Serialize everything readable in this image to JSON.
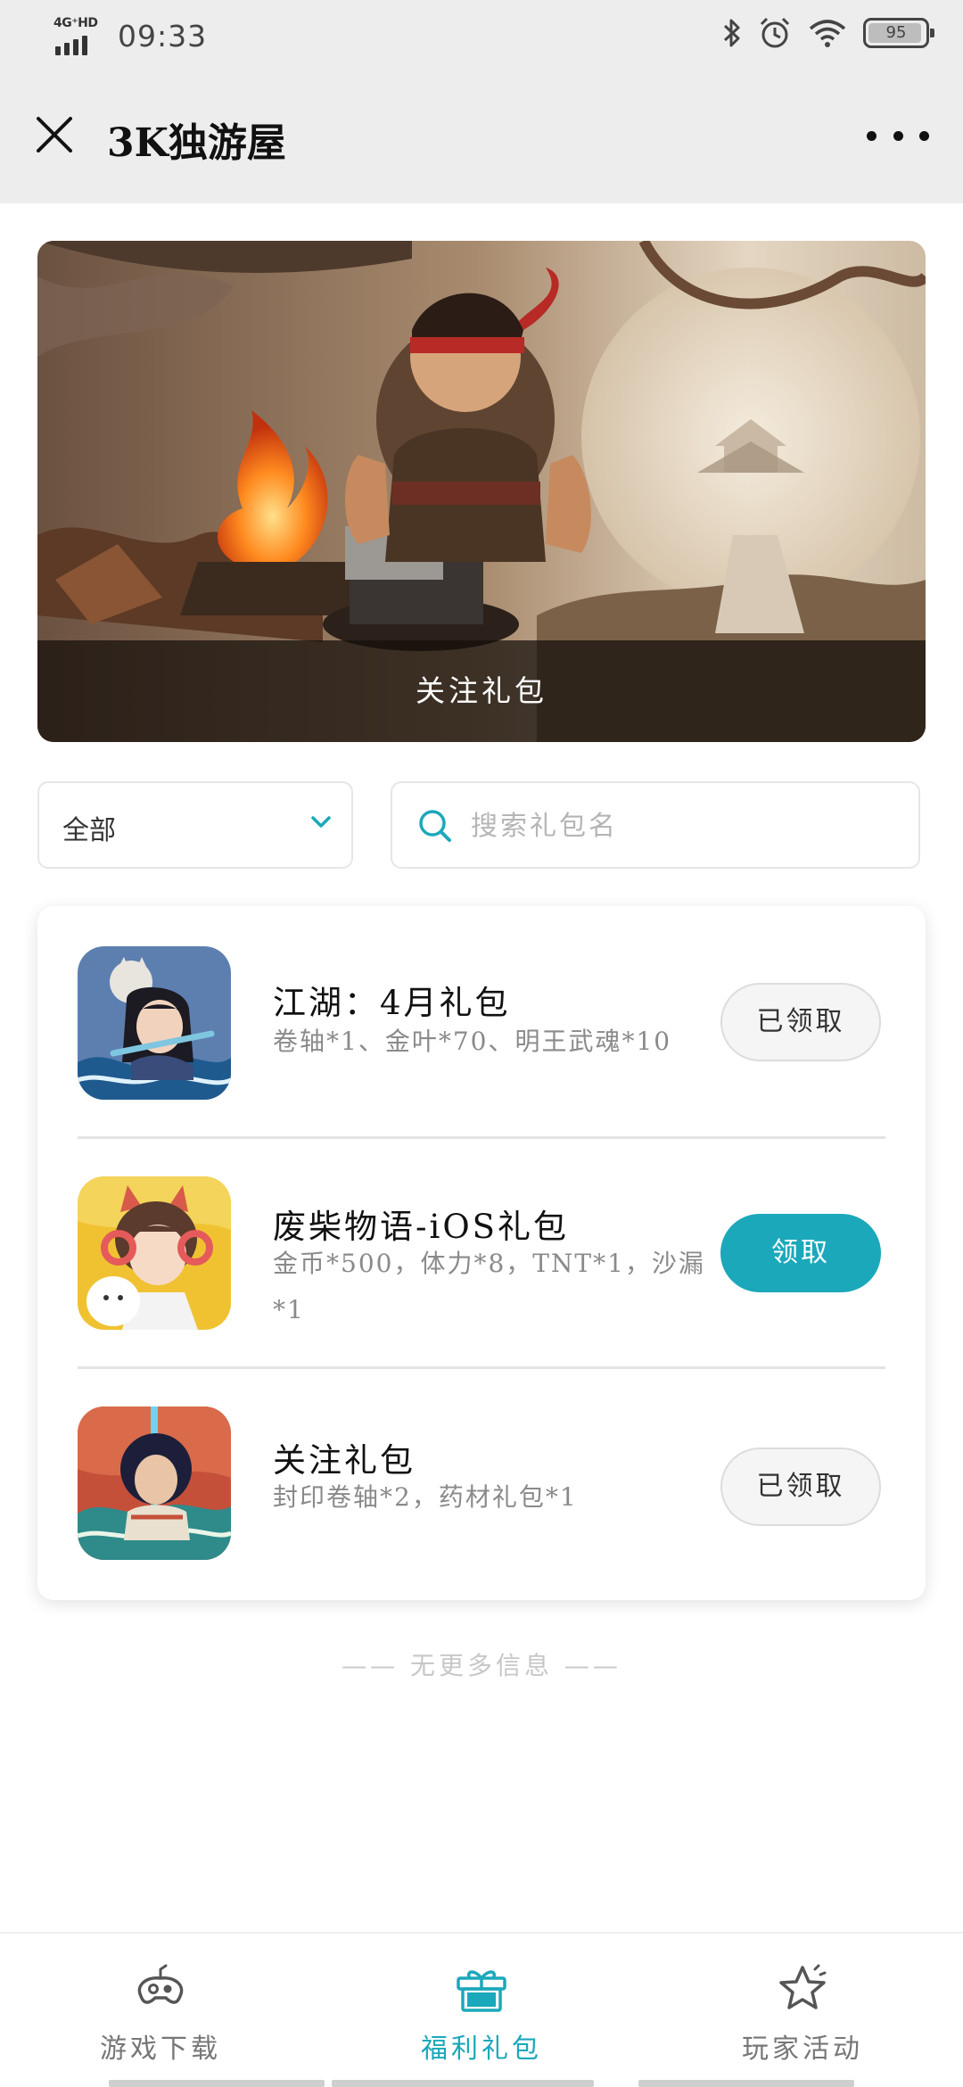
{
  "status_bar": {
    "network": "4G⁺HD",
    "time": "09:33",
    "battery": "95",
    "battery_level": 0.95,
    "icons": [
      "signal-icon",
      "bluetooth-icon",
      "alarm-icon",
      "wifi-icon",
      "battery-icon"
    ]
  },
  "header": {
    "title": "3K独游屋",
    "close_icon": "close-icon",
    "more_icon": "more-icon"
  },
  "banner": {
    "caption": "关注礼包"
  },
  "filters": {
    "category": "全部",
    "search_placeholder": "搜索礼包名"
  },
  "gifts": [
    {
      "title": "江湖：4月礼包",
      "desc": "卷轴*1、金叶*70、明王武魂*10",
      "button": "已领取",
      "claimed": true
    },
    {
      "title": "废柴物语-iOS礼包",
      "desc": "金币*500，体力*8，TNT*1，沙漏*1",
      "button": "领取",
      "claimed": false
    },
    {
      "title": "关注礼包",
      "desc": "封印卷轴*2，药材礼包*1",
      "button": "已领取",
      "claimed": true
    }
  ],
  "footer_note": "—— 无更多信息 ——",
  "bottom_nav": [
    {
      "label": "游戏下载",
      "icon": "gamepad-icon",
      "active": false
    },
    {
      "label": "福利礼包",
      "icon": "gift-icon",
      "active": true
    },
    {
      "label": "玩家活动",
      "icon": "star-icon",
      "active": false
    }
  ],
  "colors": {
    "accent": "#1ba8bb",
    "header_bg": "#ededed",
    "muted_text": "#8a8a8a"
  }
}
